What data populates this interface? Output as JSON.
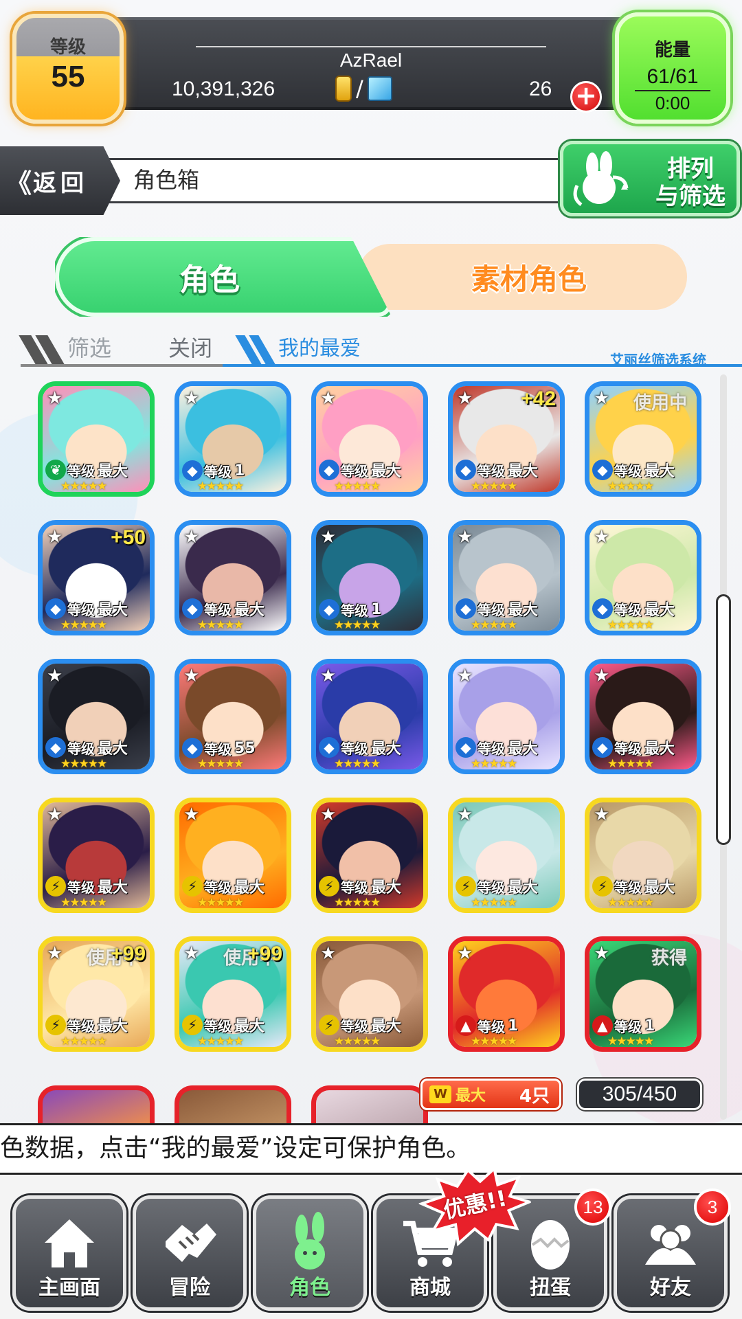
{
  "player": {
    "level_label": "等级",
    "level": "55",
    "name": "AzRael",
    "coins": "10,391,326",
    "currency_slash": "/",
    "gems": "26",
    "energy_label": "能量",
    "energy": "61/61",
    "energy_timer": "0:00"
  },
  "nav": {
    "back_label": "返回",
    "back_arrow": "《",
    "title": "角色箱",
    "sort_label_line1": "排列",
    "sort_label_line2": "与筛选"
  },
  "tabs": {
    "characters": "角色",
    "materials": "素材角色"
  },
  "filter": {
    "filter_label": "筛选",
    "filter_state": "关闭",
    "favorites": "我的最爱",
    "system_label": "艾丽丝筛选系统"
  },
  "grid": {
    "cards": [
      {
        "border": "green",
        "element": "wind",
        "level_label": "等级",
        "level": "最大",
        "plus": "",
        "inuse": "",
        "palette": [
          "#7ee8e0",
          "#ff8fb8",
          "#fde3c8"
        ]
      },
      {
        "border": "blue",
        "element": "water",
        "level_label": "等级",
        "level": "1",
        "plus": "",
        "inuse": "",
        "palette": [
          "#3bbfe0",
          "#fff1e0",
          "#e6c9a8"
        ]
      },
      {
        "border": "blue",
        "element": "water",
        "level_label": "等级",
        "level": "最大",
        "plus": "",
        "inuse": "",
        "palette": [
          "#ff9fc4",
          "#ffd1a0",
          "#fde8d8"
        ]
      },
      {
        "border": "blue",
        "element": "water",
        "level_label": "等级",
        "level": "最大",
        "plus": "+42",
        "inuse": "",
        "palette": [
          "#e8e8e8",
          "#c0392b",
          "#fde0c8"
        ]
      },
      {
        "border": "blue",
        "element": "water",
        "level_label": "等级",
        "level": "最大",
        "plus": "",
        "inuse": "使用中",
        "palette": [
          "#ffd24a",
          "#8fd1ff",
          "#fde8c8"
        ]
      },
      {
        "border": "blue",
        "element": "water",
        "level_label": "等级",
        "level": "最大",
        "plus": "+50",
        "inuse": "",
        "palette": [
          "#1f2a5c",
          "#f1d0b8",
          "#ffffff"
        ]
      },
      {
        "border": "blue",
        "element": "water",
        "level_label": "等级",
        "level": "最大",
        "plus": "",
        "inuse": "",
        "palette": [
          "#3a2a4c",
          "#ffffff",
          "#e9b8a8"
        ]
      },
      {
        "border": "blue",
        "element": "water",
        "level_label": "等级",
        "level": "1",
        "plus": "",
        "inuse": "",
        "palette": [
          "#1d6e86",
          "#2e2e38",
          "#c8a4e8"
        ]
      },
      {
        "border": "blue",
        "element": "water",
        "level_label": "等级",
        "level": "最大",
        "plus": "",
        "inuse": "",
        "palette": [
          "#b8c4cc",
          "#7b8a96",
          "#fde0d0"
        ]
      },
      {
        "border": "blue",
        "element": "water",
        "level_label": "等级",
        "level": "最大",
        "plus": "",
        "inuse": "",
        "palette": [
          "#cde8a8",
          "#fff6d8",
          "#fde0c8"
        ]
      },
      {
        "border": "blue",
        "element": "water",
        "level_label": "等级",
        "level": "最大",
        "plus": "",
        "inuse": "",
        "palette": [
          "#1a1c24",
          "#3b3f4a",
          "#f1d0b8"
        ]
      },
      {
        "border": "blue",
        "element": "water",
        "level_label": "等级",
        "level": "55",
        "plus": "",
        "inuse": "",
        "palette": [
          "#7a4a2a",
          "#ff7a7a",
          "#fde0c8"
        ]
      },
      {
        "border": "blue",
        "element": "water",
        "level_label": "等级",
        "level": "最大",
        "plus": "",
        "inuse": "",
        "palette": [
          "#2a3ca8",
          "#7a5ae8",
          "#f1d0b8"
        ]
      },
      {
        "border": "blue",
        "element": "water",
        "level_label": "等级",
        "level": "最大",
        "plus": "",
        "inuse": "",
        "palette": [
          "#a8a0e8",
          "#e8e4ff",
          "#fde0d8"
        ]
      },
      {
        "border": "blue",
        "element": "water",
        "level_label": "等级",
        "level": "最大",
        "plus": "",
        "inuse": "",
        "palette": [
          "#2a1a18",
          "#ff5a8a",
          "#fde0c8"
        ]
      },
      {
        "border": "yellow",
        "element": "thunder",
        "level_label": "等级",
        "level": "最大",
        "plus": "",
        "inuse": "",
        "palette": [
          "#2a1d48",
          "#e0b898",
          "#b83a3a"
        ]
      },
      {
        "border": "yellow",
        "element": "thunder",
        "level_label": "等级",
        "level": "最大",
        "plus": "",
        "inuse": "",
        "palette": [
          "#ffb020",
          "#ff6a00",
          "#fde0c8"
        ]
      },
      {
        "border": "yellow",
        "element": "thunder",
        "level_label": "等级",
        "level": "最大",
        "plus": "",
        "inuse": "",
        "palette": [
          "#1a1a3a",
          "#d43a2a",
          "#f1c0a8"
        ]
      },
      {
        "border": "yellow",
        "element": "thunder",
        "level_label": "等级",
        "level": "最大",
        "plus": "",
        "inuse": "",
        "palette": [
          "#c8e8e8",
          "#7ac8b8",
          "#fde8e0"
        ]
      },
      {
        "border": "yellow",
        "element": "thunder",
        "level_label": "等级",
        "level": "最大",
        "plus": "",
        "inuse": "",
        "palette": [
          "#e8d8a8",
          "#b89868",
          "#f1d8c0"
        ]
      },
      {
        "border": "yellow",
        "element": "thunder",
        "level_label": "等级",
        "level": "最大",
        "plus": "+99",
        "inuse": "使用中",
        "palette": [
          "#ffe8a8",
          "#e8a858",
          "#fde8d0"
        ]
      },
      {
        "border": "yellow",
        "element": "thunder",
        "level_label": "等级",
        "level": "最大",
        "plus": "+99",
        "inuse": "使用中",
        "palette": [
          "#3ac8b0",
          "#e8e8f8",
          "#fde0d0"
        ]
      },
      {
        "border": "yellow",
        "element": "thunder",
        "level_label": "等级",
        "level": "最大",
        "plus": "",
        "inuse": "",
        "palette": [
          "#c89878",
          "#8a5a3a",
          "#fde0c8"
        ]
      },
      {
        "border": "red",
        "element": "fire",
        "level_label": "等级",
        "level": "1",
        "plus": "",
        "inuse": "",
        "palette": [
          "#e02a2a",
          "#ffd21e",
          "#ff7a3a"
        ]
      },
      {
        "border": "red",
        "element": "fire",
        "level_label": "等级",
        "level": "1",
        "plus": "",
        "inuse": "获得",
        "palette": [
          "#1a6a3a",
          "#3ad878",
          "#fde0c8"
        ]
      }
    ],
    "partial_palettes": [
      [
        "#8a4ab8",
        "#ff9a3a"
      ],
      [
        "#8a5a3a",
        "#c89868"
      ],
      [
        "#e8d8e0",
        "#b8a0a8"
      ]
    ],
    "star_glyph": "★",
    "rarity_stars": "★★★★★"
  },
  "box": {
    "max_label": "最大",
    "max_count": "4只",
    "capacity": "305/450"
  },
  "ticker": {
    "text": "色数据，点击“我的最爱”设定可保护角色。"
  },
  "bottom_nav": [
    {
      "label": "主画面",
      "icon": "home-icon"
    },
    {
      "label": "冒险",
      "icon": "handshake-icon"
    },
    {
      "label": "角色",
      "icon": "bunny-icon"
    },
    {
      "label": "商城",
      "icon": "cart-icon"
    },
    {
      "label": "扭蛋",
      "icon": "egg-icon"
    },
    {
      "label": "好友",
      "icon": "friends-icon"
    }
  ],
  "badges": {
    "sale": "优惠!!",
    "gacha_count": "13",
    "friends_count": "3"
  },
  "colors": {
    "water": "#1e6fd6",
    "wind": "#12a84a",
    "thunder": "#e6c300",
    "fire": "#d61a1a",
    "accent_green": "#38d270",
    "accent_orange": "#ff8b1f"
  }
}
